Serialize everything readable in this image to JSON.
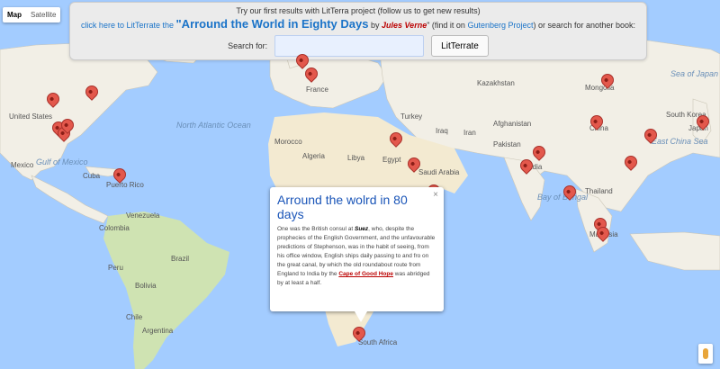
{
  "map_type": {
    "map_label": "Map",
    "satellite_label": "Satellite",
    "active": "Map"
  },
  "banner": {
    "line1": "Try our first results with LitTerra project (follow us to get new results)",
    "click_here": "click here to LitTerrate the",
    "book_title": "\"Arround the World in Eighty Days",
    "by_text": "by",
    "author": "Jules Verne",
    "find_prefix": "\" (find it on",
    "gutenberg": "Gutenberg Project",
    "find_suffix": ") or search for another book:",
    "search_label": "Search for:",
    "search_value": "",
    "button_label": "LitTerrate"
  },
  "labels": {
    "north_atlantic": "North Atlantic Ocean",
    "kazakhstan": "Kazakhstan",
    "mongolia": "Mongolia",
    "china": "China",
    "south_korea": "South Korea",
    "japan": "Japan",
    "east_china_sea": "East China Sea",
    "turkey": "Turkey",
    "iraq": "Iraq",
    "iran": "Iran",
    "afghanistan": "Afghanistan",
    "pakistan": "Pakistan",
    "india": "India",
    "bay_of_bengal": "Bay of Bengal",
    "thailand": "Thailand",
    "malaysia": "Malaysia",
    "morocco": "Morocco",
    "algeria": "Algeria",
    "libya": "Libya",
    "egypt": "Egypt",
    "saudi_arabia": "Saudi Arabia",
    "france": "France",
    "united_states": "United States",
    "mexico": "Mexico",
    "gulf_of_mexico": "Gulf of Mexico",
    "cuba": "Cuba",
    "puerto_rico": "Puerto Rico",
    "venezuela": "Venezuela",
    "colombia": "Colombia",
    "peru": "Peru",
    "brazil": "Brazil",
    "bolivia": "Bolivia",
    "chile": "Chile",
    "argentina": "Argentina",
    "south_africa": "South Africa",
    "sea_of_japan": "Sea of Japan"
  },
  "info_window": {
    "title": "Arround the wolrd in 80 days",
    "close_symbol": "×",
    "text_1": "One was the British consul at",
    "place_1": "Suez",
    "text_2": ", who, despite the prophecies of the English Government, and the unfavourable predictions of Stephenson, was in the habit of seeing, from his office window, English ships daily passing to and fro on the great canal, by which the old roundabout route from England to India by the",
    "link": "Cape of Good Hope",
    "text_3": "was abridged by at least a half."
  },
  "colors": {
    "water": "#a3ccff",
    "land": "#f2efe6",
    "pin": "#e3584c",
    "title_blue": "#1a55b8"
  }
}
